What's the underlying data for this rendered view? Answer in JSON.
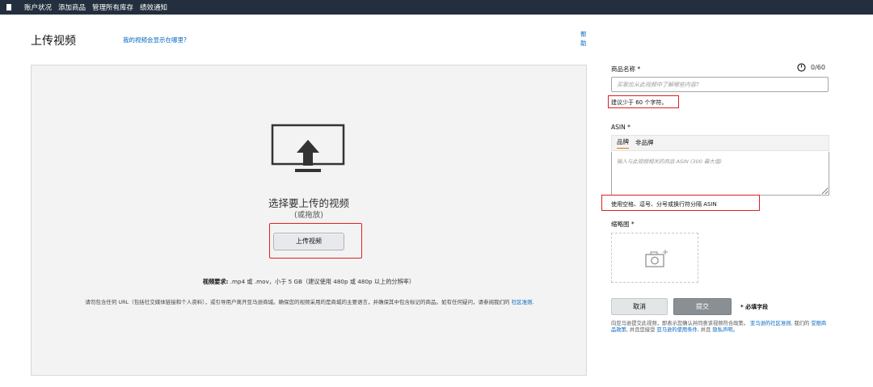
{
  "nav": {
    "items": [
      "账户状况",
      "添加商品",
      "管理所有库存",
      "绩效通知"
    ]
  },
  "header": {
    "title": "上传视频",
    "where_link": "我的视频会显示在哪里?",
    "help": "帮助"
  },
  "upload": {
    "title": "选择要上传的视频",
    "drag_hint": "(或拖放)",
    "button_label": "上传视频",
    "requirements_label": "视频要求:",
    "requirements_text": ".mp4 或 .mov，小于 5 GB（建议使用 480p 或 480p 以上的分辨率）",
    "note_text": "请勿包含任何 URL（包括社交媒体链接和个人资料），或引导用户离开亚马逊商城。确保您的视频采用的是商城的主要语言，并确保其中包含标记的商品。如有任何疑问，请参阅我们的",
    "note_link": "社区准则",
    "note_end": "."
  },
  "form": {
    "name_label": "商品名称 *",
    "name_placeholder": "买家应从此视频中了解哪些内容?",
    "name_count": "0/60",
    "name_hint": "建议少于 60 个字符。",
    "asin_label": "ASIN *",
    "tab_brand": "品牌",
    "tab_nonbrand": "非品牌",
    "asin_placeholder": "输入与此视频相关的商品 ASIN (300 最大值)",
    "asin_hint": "使用空格、逗号、分号或换行符分隔 ASIN",
    "thumb_label": "缩略图 *",
    "cancel_label": "取消",
    "submit_label": "提交",
    "required_note": "* 必填字段",
    "legal_1": "向亚马逊提交此视频，即表示您确认并同意该视频符合政策。",
    "legal_link1": "亚马逊的社区准则",
    "legal_2": ", 我们的",
    "legal_link2": "受限商品政策",
    "legal_3": ", 并且您接受",
    "legal_link3": "亚马逊的使用条件",
    "legal_4": ", 并且",
    "legal_link4": "隐私声明",
    "legal_5": "。"
  },
  "colors": {
    "nav_bg": "#232f3e",
    "link": "#0066c0",
    "highlight": "#e02020",
    "tab_accent": "#e77600"
  },
  "icons": [
    "menu-icon",
    "monitor-upload-icon",
    "clock-icon",
    "camera-add-icon"
  ]
}
